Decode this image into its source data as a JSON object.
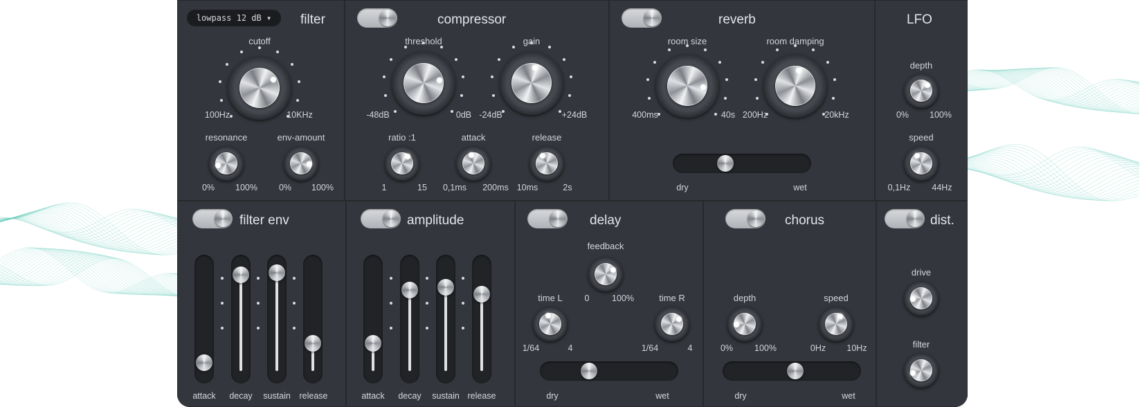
{
  "filter": {
    "title": "filter",
    "mode": "lowpass 12 dB",
    "cutoff": {
      "label": "cutoff",
      "min": "100Hz",
      "max": "10KHz",
      "value": 0.72
    },
    "resonance": {
      "label": "resonance",
      "min": "0%",
      "max": "100%",
      "value": 0.12
    },
    "env_amount": {
      "label": "env-amount",
      "min": "0%",
      "max": "100%",
      "value": 0.85
    }
  },
  "compressor": {
    "title": "compressor",
    "enabled": true,
    "threshold": {
      "label": "threshold",
      "min": "-48dB",
      "max": "0dB",
      "value": 0.8
    },
    "gain": {
      "label": "gain",
      "min": "-24dB",
      "max": "+24dB",
      "value": 0.55
    },
    "ratio": {
      "label": "ratio :1",
      "min": "1",
      "max": "15",
      "value": 0.65
    },
    "attack": {
      "label": "attack",
      "min": "0,1ms",
      "max": "200ms",
      "value": 0.45
    },
    "release": {
      "label": "release",
      "min": "10ms",
      "max": "2s",
      "value": 0.4
    }
  },
  "reverb": {
    "title": "reverb",
    "enabled": true,
    "room_size": {
      "label": "room size",
      "min": "400ms",
      "max": "40s",
      "value": 0.85
    },
    "room_damping": {
      "label": "room damping",
      "min": "200Hz",
      "max": "20kHz",
      "value": 0.55
    },
    "mix": {
      "min": "dry",
      "max": "wet",
      "value": 0.36
    }
  },
  "lfo": {
    "title": "LFO",
    "depth": {
      "label": "depth",
      "min": "0%",
      "max": "100%",
      "value": 0.68
    },
    "speed": {
      "label": "speed",
      "min": "0,1Hz",
      "max": "44Hz",
      "value": 0.4
    }
  },
  "filter_env": {
    "title": "filter env",
    "enabled": true,
    "sliders": [
      {
        "label": "attack",
        "value": 0.08
      },
      {
        "label": "decay",
        "value": 0.93
      },
      {
        "label": "sustain",
        "value": 0.95
      },
      {
        "label": "release",
        "value": 0.27
      }
    ]
  },
  "amplitude": {
    "title": "amplitude",
    "enabled": true,
    "sliders": [
      {
        "label": "attack",
        "value": 0.27
      },
      {
        "label": "decay",
        "value": 0.78
      },
      {
        "label": "sustain",
        "value": 0.81
      },
      {
        "label": "release",
        "value": 0.74
      }
    ]
  },
  "delay": {
    "title": "delay",
    "enabled": true,
    "feedback": {
      "label": "feedback",
      "min": "0",
      "max": "100%",
      "value": 0.72
    },
    "time_l": {
      "label": "time L",
      "min": "1/64",
      "max": "4",
      "value": 0.45
    },
    "time_r": {
      "label": "time R",
      "min": "1/64",
      "max": "4",
      "value": 0.7
    },
    "mix": {
      "min": "dry",
      "max": "wet",
      "value": 0.33
    }
  },
  "chorus": {
    "title": "chorus",
    "enabled": true,
    "depth": {
      "label": "depth",
      "min": "0%",
      "max": "100%",
      "value": 0.15
    },
    "speed": {
      "label": "speed",
      "min": "0Hz",
      "max": "10Hz",
      "value": 0.6
    },
    "mix": {
      "min": "dry",
      "max": "wet",
      "value": 0.53
    }
  },
  "dist": {
    "title": "dist.",
    "enabled": true,
    "drive": {
      "label": "drive",
      "value": 0.15
    },
    "filter": {
      "label": "filter",
      "value": 0.1
    }
  },
  "colors": {
    "panel": "#33363c",
    "background": "#2e3035",
    "text": "#d4d6db",
    "wave": "#5ec8b8"
  }
}
